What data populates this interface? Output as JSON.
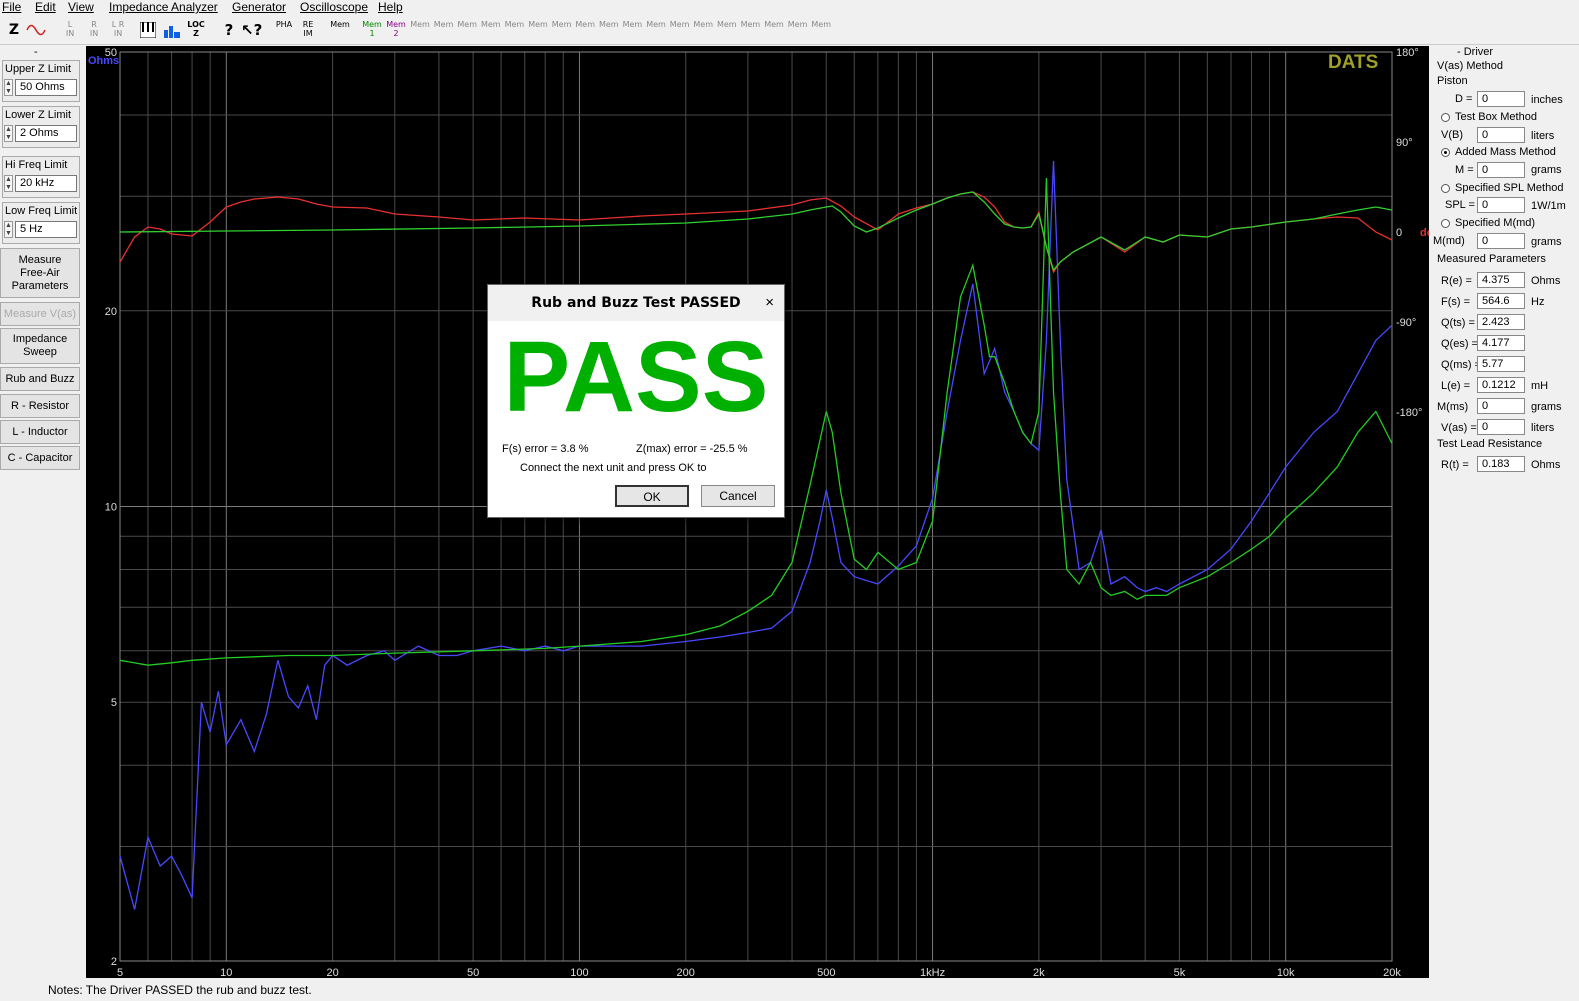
{
  "menu": [
    "File",
    "Edit",
    "View",
    "Impedance Analyzer",
    "Generator",
    "Oscilloscope",
    "Help"
  ],
  "toolbar": {
    "z": "Z",
    "l_in": "L\nIN",
    "r_in": "R\nIN",
    "lr_in": "L R\nIN",
    "loc_z": "LOC\nZ",
    "pha": "PHA",
    "re_im": "RE\nIM",
    "mem": "Mem",
    "mem1": "Mem\n1",
    "mem2": "Mem\n2"
  },
  "left": {
    "dash": "-",
    "upper": {
      "label": "Upper Z Limit",
      "value": "50 Ohms"
    },
    "lower": {
      "label": "Lower Z Limit",
      "value": "2 Ohms"
    },
    "hi": {
      "label": "Hi Freq Limit",
      "value": "20 kHz"
    },
    "low": {
      "label": "Low Freq Limit",
      "value": "5 Hz"
    },
    "buttons": [
      "Measure Free-Air Parameters",
      "Measure V(as)",
      "Impedance Sweep",
      "Rub and Buzz",
      "R - Resistor",
      "L - Inductor",
      "C - Capacitor"
    ]
  },
  "plot": {
    "brand": "DATS",
    "unit_left": "Ohms",
    "unit_right": "deg",
    "y_left_ticks": [
      "50",
      "20",
      "10",
      "5",
      "2"
    ],
    "y_right_ticks": [
      "180°",
      "90°",
      "0",
      "-90°",
      "-180°"
    ],
    "x_ticks": [
      "5",
      "10",
      "20",
      "50",
      "100",
      "200",
      "500",
      "1kHz",
      "2k",
      "5k",
      "10k",
      "20k"
    ]
  },
  "chart_data": {
    "type": "line",
    "xlabel": "",
    "ylabel": "Ohms",
    "y2label": "deg",
    "xscale": "log",
    "yscale": "log",
    "xlim": [
      5,
      20000
    ],
    "ylim": [
      2,
      50
    ],
    "y2lim": [
      -180,
      180
    ],
    "grid": true,
    "series": [
      {
        "axis": "left",
        "color": "#4848ff",
        "x": [
          5,
          5.5,
          6,
          6.5,
          7,
          7.5,
          8,
          8.5,
          9,
          9.5,
          10,
          11,
          12,
          13,
          14,
          15,
          16,
          17,
          18,
          19,
          20,
          22,
          25,
          28,
          30,
          35,
          40,
          45,
          50,
          60,
          70,
          80,
          90,
          100,
          120,
          150,
          200,
          250,
          300,
          350,
          400,
          450,
          480,
          500,
          520,
          550,
          600,
          700,
          800,
          900,
          1000,
          1100,
          1200,
          1300,
          1400,
          1500,
          1600,
          1700,
          1800,
          1900,
          2000,
          2100,
          2200,
          2300,
          2400,
          2600,
          2800,
          3000,
          3200,
          3500,
          3800,
          4000,
          4300,
          4600,
          5000,
          6000,
          7000,
          8000,
          9000,
          10000,
          12000,
          14000,
          16000,
          18000,
          20000
        ],
        "y": [
          2.9,
          2.4,
          3.1,
          2.8,
          2.9,
          2.7,
          2.5,
          5,
          4.5,
          5.2,
          4.3,
          4.7,
          4.2,
          4.8,
          5.8,
          5.1,
          4.9,
          5.3,
          4.7,
          5.7,
          5.9,
          5.7,
          5.9,
          6,
          5.8,
          6.1,
          5.9,
          5.9,
          6,
          6.1,
          6,
          6.1,
          6,
          6.1,
          6.1,
          6.1,
          6.2,
          6.3,
          6.4,
          6.5,
          6.9,
          8.2,
          9.5,
          10.6,
          9.6,
          8.2,
          7.8,
          7.6,
          8.1,
          8.7,
          10.3,
          14,
          18,
          22,
          16,
          17.5,
          15,
          14,
          13,
          12.5,
          12.2,
          18,
          34,
          18,
          11,
          8,
          8.2,
          9.2,
          7.6,
          7.8,
          7.5,
          7.4,
          7.5,
          7.4,
          7.6,
          8,
          8.6,
          9.5,
          10.5,
          11.5,
          13,
          14,
          16,
          18,
          19
        ]
      },
      {
        "axis": "left",
        "color": "#22cc22",
        "x": [
          5,
          6,
          7,
          8,
          10,
          15,
          20,
          30,
          50,
          80,
          100,
          150,
          200,
          250,
          300,
          350,
          400,
          450,
          500,
          520,
          550,
          600,
          650,
          700,
          800,
          900,
          1000,
          1100,
          1200,
          1300,
          1400,
          1450,
          1500,
          1600,
          1700,
          1800,
          1900,
          2000,
          2100,
          2200,
          2300,
          2400,
          2600,
          2800,
          3000,
          3200,
          3500,
          3800,
          4000,
          4300,
          4600,
          5000,
          6000,
          7000,
          8000,
          9000,
          10000,
          12000,
          14000,
          16000,
          18000,
          20000
        ],
        "y": [
          5.8,
          5.7,
          5.75,
          5.8,
          5.85,
          5.9,
          5.9,
          5.95,
          6,
          6.05,
          6.1,
          6.2,
          6.35,
          6.55,
          6.9,
          7.3,
          8.2,
          10.8,
          14,
          13,
          10.5,
          8.3,
          8,
          8.5,
          8,
          8.2,
          9.5,
          15,
          21,
          23.5,
          19,
          17,
          17,
          15.5,
          14,
          13,
          12.5,
          14,
          32,
          15,
          10.5,
          8,
          7.6,
          8.2,
          7.5,
          7.3,
          7.4,
          7.2,
          7.3,
          7.3,
          7.3,
          7.5,
          7.8,
          8.2,
          8.6,
          9,
          9.6,
          10.5,
          11.5,
          13,
          14,
          12.5
        ]
      },
      {
        "axis": "right",
        "color": "#e83030",
        "x": [
          5,
          5.5,
          6,
          6.5,
          7,
          7.5,
          8,
          9,
          10,
          11,
          12,
          14,
          16,
          18,
          20,
          25,
          30,
          40,
          50,
          70,
          100,
          150,
          200,
          300,
          400,
          450,
          500,
          550,
          600,
          700,
          800,
          900,
          1000,
          1100,
          1200,
          1300,
          1400,
          1500,
          1600,
          1700,
          1800,
          1900,
          2000,
          2100,
          2200,
          2300,
          2500,
          3000,
          3500,
          4000,
          4500,
          5000,
          6000,
          7000,
          8000,
          10000,
          12000,
          14000,
          16000,
          18000,
          20000
        ],
        "y": [
          -30,
          -5,
          5,
          3,
          -2,
          -3,
          -4,
          10,
          25,
          30,
          33,
          35,
          33,
          28,
          25,
          24,
          18,
          15,
          12,
          14,
          12,
          16,
          18,
          21,
          27,
          32,
          34,
          26,
          15,
          2,
          18,
          24,
          28,
          34,
          38,
          40,
          35,
          25,
          10,
          5,
          4,
          5,
          20,
          -15,
          -40,
          -30,
          -20,
          -5,
          -20,
          -5,
          -10,
          -3,
          -5,
          3,
          5,
          10,
          13,
          15,
          14,
          0,
          -8
        ]
      },
      {
        "axis": "right",
        "color": "#30d030",
        "x": [
          5,
          10,
          20,
          50,
          100,
          200,
          300,
          400,
          450,
          500,
          520,
          550,
          600,
          650,
          700,
          800,
          900,
          1000,
          1100,
          1200,
          1300,
          1400,
          1500,
          1600,
          1700,
          1800,
          1900,
          2000,
          2100,
          2200,
          2300,
          2500,
          3000,
          3500,
          4000,
          4500,
          5000,
          6000,
          7000,
          8000,
          10000,
          12000,
          14000,
          16000,
          18000,
          20000
        ],
        "y": [
          0,
          1,
          2,
          4,
          6,
          9,
          13,
          18,
          22,
          25,
          26,
          20,
          6,
          0,
          4,
          14,
          22,
          28,
          34,
          38,
          40,
          30,
          18,
          8,
          5,
          4,
          5,
          18,
          -15,
          -38,
          -30,
          -20,
          -5,
          -18,
          -5,
          -10,
          -3,
          -5,
          3,
          5,
          10,
          13,
          18,
          22,
          25,
          22
        ]
      }
    ]
  },
  "right": {
    "header": "- Driver",
    "vas": "V(as) Method",
    "piston": "Piston",
    "d_label": "D =",
    "d_value": "0",
    "d_unit": "inches",
    "testbox": "Test Box Method",
    "vb_label": "V(B)",
    "vb_value": "0",
    "vb_unit": "liters",
    "added": "Added Mass Method",
    "m_label": "M =",
    "m_value": "0",
    "m_unit": "grams",
    "spl_method": "Specified SPL Method",
    "spl_label": "SPL =",
    "spl_value": "0",
    "spl_unit": "1W/1m",
    "mmd_method": "Specified M(md)",
    "mmd_label": "M(md)",
    "mmd_value": "0",
    "mmd_unit": "grams",
    "measured": "Measured Parameters",
    "params": [
      {
        "label": "R(e) =",
        "value": "4.375",
        "unit": "Ohms"
      },
      {
        "label": "F(s) =",
        "value": "564.6",
        "unit": "Hz"
      },
      {
        "label": "Q(ts) =",
        "value": "2.423",
        "unit": ""
      },
      {
        "label": "Q(es) =",
        "value": "4.177",
        "unit": ""
      },
      {
        "label": "Q(ms) =",
        "value": "5.77",
        "unit": ""
      },
      {
        "label": "L(e) =",
        "value": "0.1212",
        "unit": "mH"
      },
      {
        "label": "M(ms)",
        "value": "0",
        "unit": "grams"
      },
      {
        "label": "V(as) =",
        "value": "0",
        "unit": "liters"
      }
    ],
    "lead": "Test Lead Resistance",
    "rt_label": "R(t) =",
    "rt_value": "0.183",
    "rt_unit": "Ohms"
  },
  "dialog": {
    "title": "Rub and Buzz Test PASSED",
    "close": "×",
    "big": "PASS",
    "fs_error": "F(s) error = 3.8 %",
    "zmax_error": "Z(max) error = -25.5 %",
    "message": "Connect the next unit and press OK to",
    "ok": "OK",
    "cancel": "Cancel"
  },
  "notes": "Notes:  The Driver PASSED the rub and buzz test."
}
